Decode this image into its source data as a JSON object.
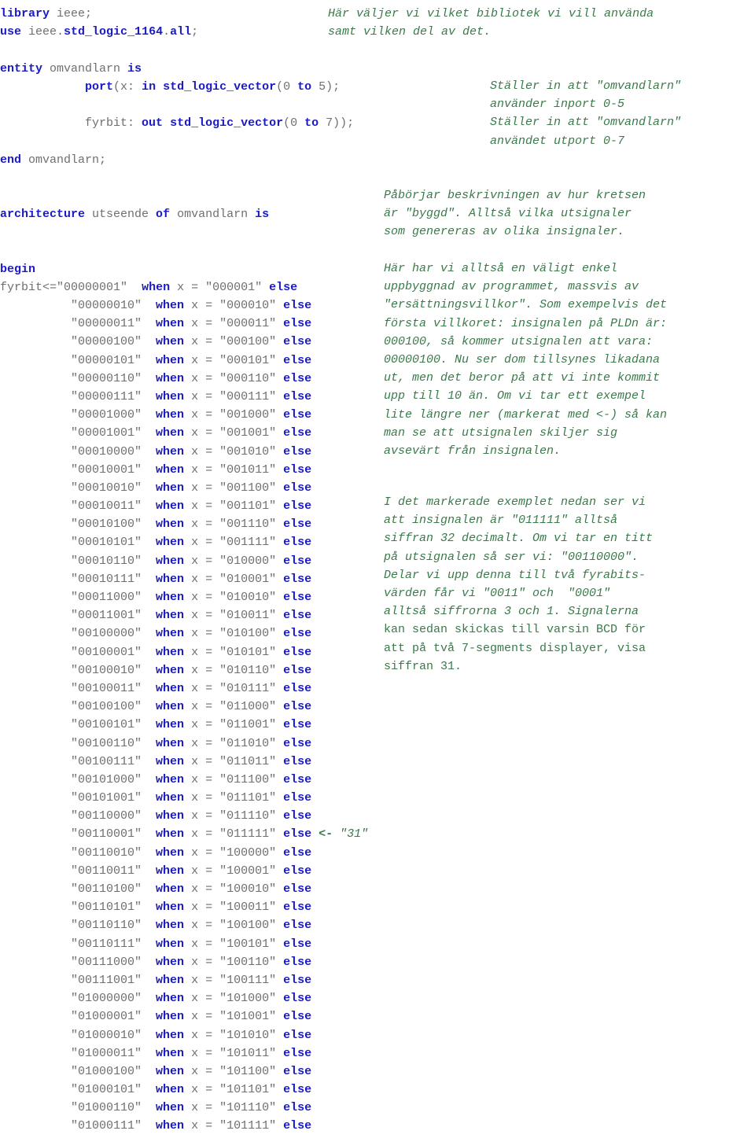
{
  "colors": {
    "keyword": "#1a1ac6",
    "identifier": "#6f6f6f",
    "comment": "#3a7a4a",
    "background": "#ffffff"
  },
  "code": {
    "header_lines": [
      {
        "indent": 0,
        "tokens": [
          {
            "t": "library",
            "k": "kw"
          },
          {
            "t": " ",
            "k": "sp"
          },
          {
            "t": "ieee;",
            "k": "id"
          }
        ]
      },
      {
        "indent": 0,
        "tokens": [
          {
            "t": "use",
            "k": "kw"
          },
          {
            "t": " ",
            "k": "sp"
          },
          {
            "t": "ieee.",
            "k": "id"
          },
          {
            "t": "std_logic_1164",
            "k": "kw"
          },
          {
            "t": ".",
            "k": "id"
          },
          {
            "t": "all",
            "k": "kw"
          },
          {
            "t": ";",
            "k": "id"
          }
        ]
      }
    ],
    "entity_lines": [
      {
        "indent": 0,
        "tokens": [
          {
            "t": "entity",
            "k": "kw"
          },
          {
            "t": " omvandlarn ",
            "k": "id"
          },
          {
            "t": "is",
            "k": "kw"
          }
        ]
      },
      {
        "indent": 0,
        "tokens": [
          {
            "t": "            ",
            "k": "sp"
          },
          {
            "t": "port",
            "k": "kw"
          },
          {
            "t": "(x: ",
            "k": "id"
          },
          {
            "t": "in",
            "k": "kw"
          },
          {
            "t": " ",
            "k": "sp"
          },
          {
            "t": "std_logic_vector",
            "k": "kw"
          },
          {
            "t": "(0 ",
            "k": "id"
          },
          {
            "t": "to",
            "k": "kw"
          },
          {
            "t": " 5);",
            "k": "id"
          }
        ]
      },
      {
        "indent": 0,
        "tokens": [
          {
            "t": "            fyrbit: ",
            "k": "id"
          },
          {
            "t": "out",
            "k": "kw"
          },
          {
            "t": " ",
            "k": "sp"
          },
          {
            "t": "std_logic_vector",
            "k": "kw"
          },
          {
            "t": "(0 ",
            "k": "id"
          },
          {
            "t": "to",
            "k": "kw"
          },
          {
            "t": " 7));",
            "k": "id"
          }
        ]
      },
      {
        "indent": 0,
        "tokens": [
          {
            "t": "end",
            "k": "kw"
          },
          {
            "t": " omvandlarn;",
            "k": "id"
          }
        ]
      }
    ],
    "architecture_line": {
      "tokens": [
        {
          "t": "architecture",
          "k": "kw"
        },
        {
          "t": " utseende ",
          "k": "id"
        },
        {
          "t": "of",
          "k": "kw"
        },
        {
          "t": " omvandlarn ",
          "k": "id"
        },
        {
          "t": "is",
          "k": "kw"
        }
      ]
    },
    "begin_line": {
      "tokens": [
        {
          "t": "begin",
          "k": "kw"
        }
      ]
    },
    "signal_name": "fyrbit",
    "assign_op": "<=",
    "when_kw": "when",
    "else_kw": "else",
    "input_name": "x",
    "eq_op": "=",
    "marker": {
      "arrow": "<-",
      "text": " \"31\""
    },
    "assignments": [
      {
        "out": "00000001",
        "in": "000001"
      },
      {
        "out": "00000010",
        "in": "000010"
      },
      {
        "out": "00000011",
        "in": "000011"
      },
      {
        "out": "00000100",
        "in": "000100"
      },
      {
        "out": "00000101",
        "in": "000101"
      },
      {
        "out": "00000110",
        "in": "000110"
      },
      {
        "out": "00000111",
        "in": "000111"
      },
      {
        "out": "00001000",
        "in": "001000"
      },
      {
        "out": "00001001",
        "in": "001001"
      },
      {
        "out": "00010000",
        "in": "001010"
      },
      {
        "out": "00010001",
        "in": "001011"
      },
      {
        "out": "00010010",
        "in": "001100"
      },
      {
        "out": "00010011",
        "in": "001101"
      },
      {
        "out": "00010100",
        "in": "001110"
      },
      {
        "out": "00010101",
        "in": "001111"
      },
      {
        "out": "00010110",
        "in": "010000"
      },
      {
        "out": "00010111",
        "in": "010001"
      },
      {
        "out": "00011000",
        "in": "010010"
      },
      {
        "out": "00011001",
        "in": "010011"
      },
      {
        "out": "00100000",
        "in": "010100"
      },
      {
        "out": "00100001",
        "in": "010101"
      },
      {
        "out": "00100010",
        "in": "010110"
      },
      {
        "out": "00100011",
        "in": "010111"
      },
      {
        "out": "00100100",
        "in": "011000"
      },
      {
        "out": "00100101",
        "in": "011001"
      },
      {
        "out": "00100110",
        "in": "011010"
      },
      {
        "out": "00100111",
        "in": "011011"
      },
      {
        "out": "00101000",
        "in": "011100"
      },
      {
        "out": "00101001",
        "in": "011101"
      },
      {
        "out": "00110000",
        "in": "011110"
      },
      {
        "out": "00110001",
        "in": "011111",
        "marked": true
      },
      {
        "out": "00110010",
        "in": "100000"
      },
      {
        "out": "00110011",
        "in": "100001"
      },
      {
        "out": "00110100",
        "in": "100010"
      },
      {
        "out": "00110101",
        "in": "100011"
      },
      {
        "out": "00110110",
        "in": "100100"
      },
      {
        "out": "00110111",
        "in": "100101"
      },
      {
        "out": "00111000",
        "in": "100110"
      },
      {
        "out": "00111001",
        "in": "100111"
      },
      {
        "out": "01000000",
        "in": "101000"
      },
      {
        "out": "01000001",
        "in": "101001"
      },
      {
        "out": "01000010",
        "in": "101010"
      },
      {
        "out": "01000011",
        "in": "101011"
      },
      {
        "out": "01000100",
        "in": "101100"
      },
      {
        "out": "01000101",
        "in": "101101"
      },
      {
        "out": "01000110",
        "in": "101110"
      },
      {
        "out": "01000111",
        "in": "101111"
      }
    ]
  },
  "comments": {
    "header": [
      "Här väljer vi vilket bibliotek vi vill använda",
      "samt vilken del av det."
    ],
    "entity": [
      "Ställer in att \"omvandlarn\"",
      "använder inport 0-5",
      "Ställer in att \"omvandlarn\"",
      "använd"
    ],
    "entity_full": [
      "Ställer in att \"omvandlarn\"",
      "använder inport 0-5",
      "Ställer in att \"omvandlarn\"",
      "användet utport 0-7"
    ],
    "architecture": [
      "Påbörjar beskrivningen av hur kretsen",
      "är \"byggd\". Alltså vilka utsignaler",
      "som genereras av olika insignaler."
    ],
    "body": [
      "Här har vi alltså en väligt enkel",
      "uppbyggnad av programmet, massvis av",
      "\"ersättningsvillkor\". Som exempelvis det",
      "första villkoret: insignalen på PLDn är:",
      "000100, så kommer utsignalen att vara:",
      "00000100. Nu ser dom tillsynes likadana",
      "ut, men det beror på att vi inte kommit",
      "upp till 10 än. Om vi tar ett exempel",
      "lite längre ner (markerat med <-) så kan",
      "man se att utsignalen skiljer sig",
      "avsevärt från insignalen."
    ],
    "body2": [
      "I det markerade exemplet nedan ser vi",
      "att insignalen är \"011111\" alltså",
      "siffran 32 decimalt. Om vi tar en titt",
      "på utsignalen så ser vi: \"00110000\".",
      "Delar vi upp denna till två fyrabits-",
      "värden får vi \"0011\" och  \"0001\"",
      "alltså siffrorna 3 och 1. Signalerna"
    ],
    "body3": [
      "kan sedan skickas till varsin BCD för",
      "att på två 7-segments displayer, visa",
      "siffran 31."
    ]
  }
}
